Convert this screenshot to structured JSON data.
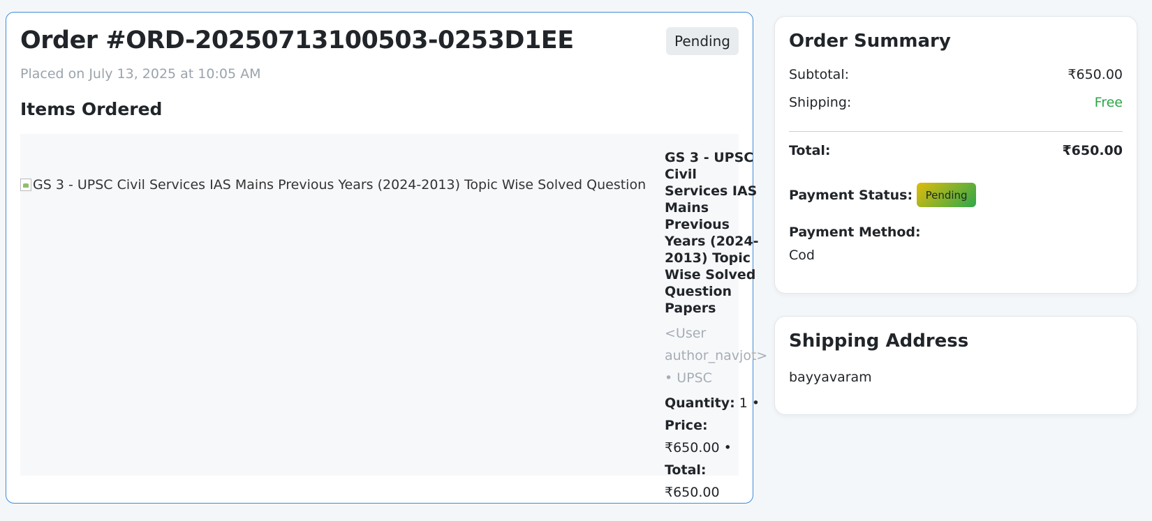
{
  "order": {
    "title": "Order #ORD-20250713100503-0253D1EE",
    "status": "Pending",
    "placed_on": "Placed on July 13, 2025 at 10:05 AM",
    "items_heading": "Items Ordered",
    "item": {
      "image_alt": "GS 3 - UPSC Civil Services IAS Mains Previous Years (2024-2013) Topic Wise Solved Question Papers",
      "name": "GS 3 - UPSC Civil Services IAS Mains Previous Years (2024-2013) Topic Wise Solved Question Papers",
      "author": "<User author_navjot>",
      "category": "• UPSC",
      "quantity_label": "Quantity:",
      "quantity": "1",
      "price_label": "Price:",
      "price": "₹650.00",
      "total_label": "Total:",
      "total": "₹650.00"
    }
  },
  "summary": {
    "title": "Order Summary",
    "subtotal_label": "Subtotal:",
    "subtotal": "₹650.00",
    "shipping_label": "Shipping:",
    "shipping": "Free",
    "total_label": "Total:",
    "total": "₹650.00",
    "payment_status_label": "Payment Status:",
    "payment_status": "Pending",
    "payment_method_label": "Payment Method:",
    "payment_method": "Cod"
  },
  "shipping_address": {
    "title": "Shipping Address",
    "address": "bayyavaram"
  },
  "colors": {
    "card_border": "#3d8bd6",
    "free_green": "#28a745",
    "muted": "#9aa3ab"
  }
}
